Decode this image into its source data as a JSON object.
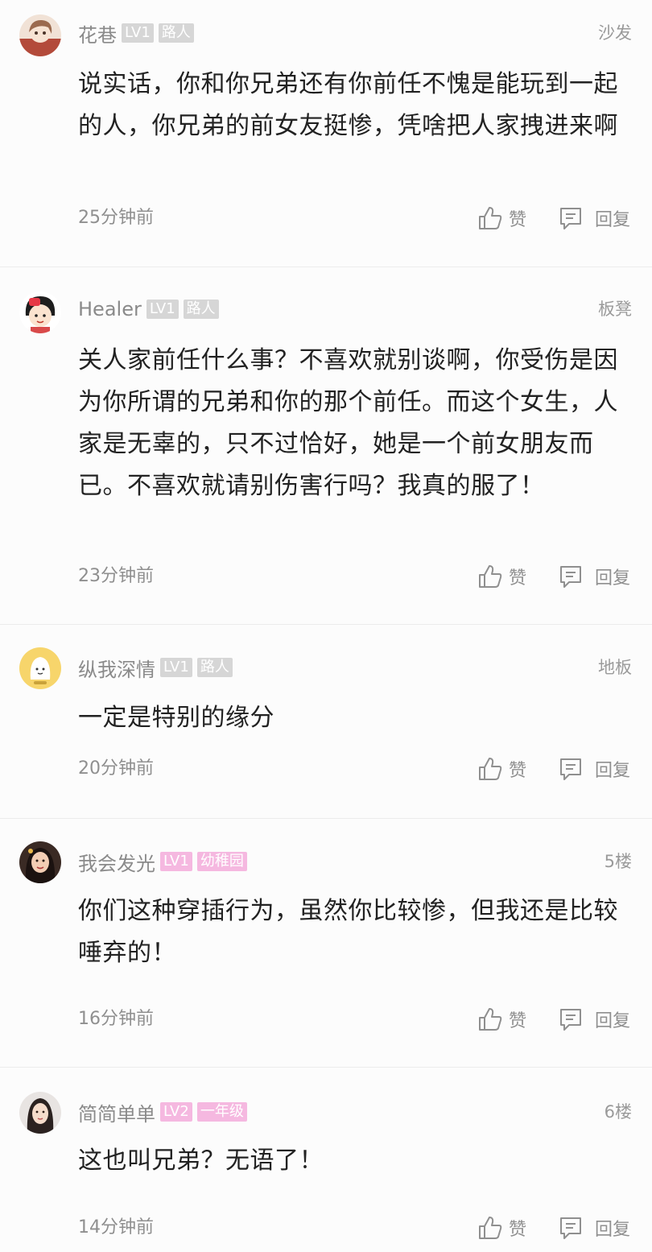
{
  "actions": {
    "like_label": "赞",
    "reply_label": "回复"
  },
  "comments": [
    {
      "username": "花巷",
      "level": "LV1",
      "rank": "路人",
      "floor": "沙发",
      "text": "说实话，你和你兄弟还有你前任不愧是能玩到一起的人，你兄弟的前女友挺惨，凭啥把人家拽进来啊",
      "time": "25分钟前",
      "badge_color": "#d6d6d6"
    },
    {
      "username": "Healer",
      "level": "LV1",
      "rank": "路人",
      "floor": "板凳",
      "text": "关人家前任什么事？不喜欢就别谈啊，你受伤是因为你所谓的兄弟和你的那个前任。而这个女生，人家是无辜的，只不过恰好，她是一个前女朋友而已。不喜欢就请别伤害行吗？我真的服了！",
      "time": "23分钟前",
      "badge_color": "#d6d6d6"
    },
    {
      "username": "纵我深情",
      "level": "LV1",
      "rank": "路人",
      "floor": "地板",
      "text": "一定是特别的缘分",
      "time": "20分钟前",
      "badge_color": "#d6d6d6"
    },
    {
      "username": "我会发光",
      "level": "LV1",
      "rank": "幼稚园",
      "floor": "5楼",
      "text": "你们这种穿插行为，虽然你比较惨，但我还是比较唾弃的！",
      "time": "16分钟前",
      "badge_color": "#f5b8e0"
    },
    {
      "username": "简简单单",
      "level": "LV2",
      "rank": "一年级",
      "floor": "6楼",
      "text": "这也叫兄弟？无语了！",
      "time": "14分钟前",
      "badge_color": "#f5b8e0"
    }
  ]
}
